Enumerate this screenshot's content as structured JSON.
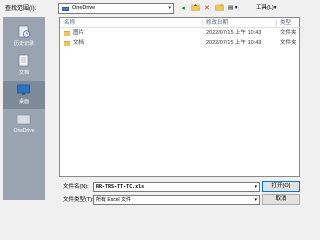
{
  "toolbar": {
    "look_in_label": "查找范围(I):",
    "look_in_value": "OneDrive",
    "back_icon": "◂",
    "up_icon": "up-folder",
    "delete_icon": "✕",
    "new_folder_icon": "new-folder",
    "views_label": "▤ ▾",
    "tools_label": "工具(L)▾"
  },
  "places": [
    {
      "label": "历史记录",
      "icon": "history-icon"
    },
    {
      "label": "文档",
      "icon": "documents-icon"
    },
    {
      "label": "桌面",
      "icon": "desktop-icon"
    },
    {
      "label": "OneDrive",
      "icon": "onedrive-icon"
    }
  ],
  "list": {
    "columns": [
      "名称",
      "修改日期",
      "类型"
    ],
    "rows": [
      {
        "name": "图片",
        "date": "2022/07/15 上午 10:43",
        "type": "文件夹"
      },
      {
        "name": "文档",
        "date": "2022/07/15 上午 10:43",
        "type": "文件夹"
      }
    ]
  },
  "filename": {
    "label": "文件名(N):",
    "value": "RR-TRS-TT-TC.xls",
    "open_label": "打开(O)"
  },
  "filetype": {
    "label": "文件类型(T):",
    "value": "所有 Excel 文件",
    "cancel_label": "取消"
  }
}
